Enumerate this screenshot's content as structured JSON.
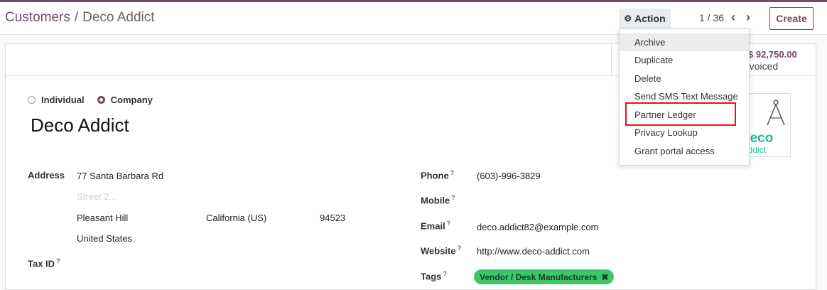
{
  "breadcrumb": {
    "parent": "Customers",
    "separator": "/",
    "current": "Deco Addict"
  },
  "toolbar": {
    "action_label": "Action",
    "action_icon": "gear-icon",
    "create_label": "Create"
  },
  "pager": {
    "value": "1 / 36",
    "prev_icon": "chevron-left-icon",
    "next_icon": "chevron-right-icon"
  },
  "stat": {
    "value": "$ 92,750.00",
    "value_visible": "$ 92,750.00",
    "label": "Invoiced"
  },
  "company_type": {
    "options": [
      "Individual",
      "Company"
    ],
    "selected": "Company"
  },
  "name": "Deco Addict",
  "logo": {
    "brand": "deco",
    "tagline": "addict"
  },
  "address": {
    "label": "Address",
    "street": "77 Santa Barbara Rd",
    "street2_placeholder": "Street 2...",
    "city": "Pleasant Hill",
    "state": "California (US)",
    "zip": "94523",
    "country": "United States"
  },
  "tax_id": {
    "label": "Tax ID",
    "help": "?"
  },
  "contact": {
    "phone_label": "Phone",
    "phone": "(603)-996-3829",
    "mobile_label": "Mobile",
    "mobile": "",
    "email_label": "Email",
    "email": "deco.addict82@example.com",
    "website_label": "Website",
    "website": "http://www.deco-addict.com",
    "tags_label": "Tags",
    "tags": [
      "Vendor / Desk Manufacturers"
    ],
    "help": "?"
  },
  "action_menu": {
    "items": [
      "Archive",
      "Duplicate",
      "Delete",
      "Send SMS Text Message",
      "Partner Ledger",
      "Privacy Lookup",
      "Grant portal access"
    ],
    "hovered": "Archive",
    "highlighted": "Partner Ledger"
  },
  "colors": {
    "brand": "#714b67",
    "tag": "#3cc66b",
    "highlight": "#ee1111",
    "logo": "#1dbf9a"
  }
}
